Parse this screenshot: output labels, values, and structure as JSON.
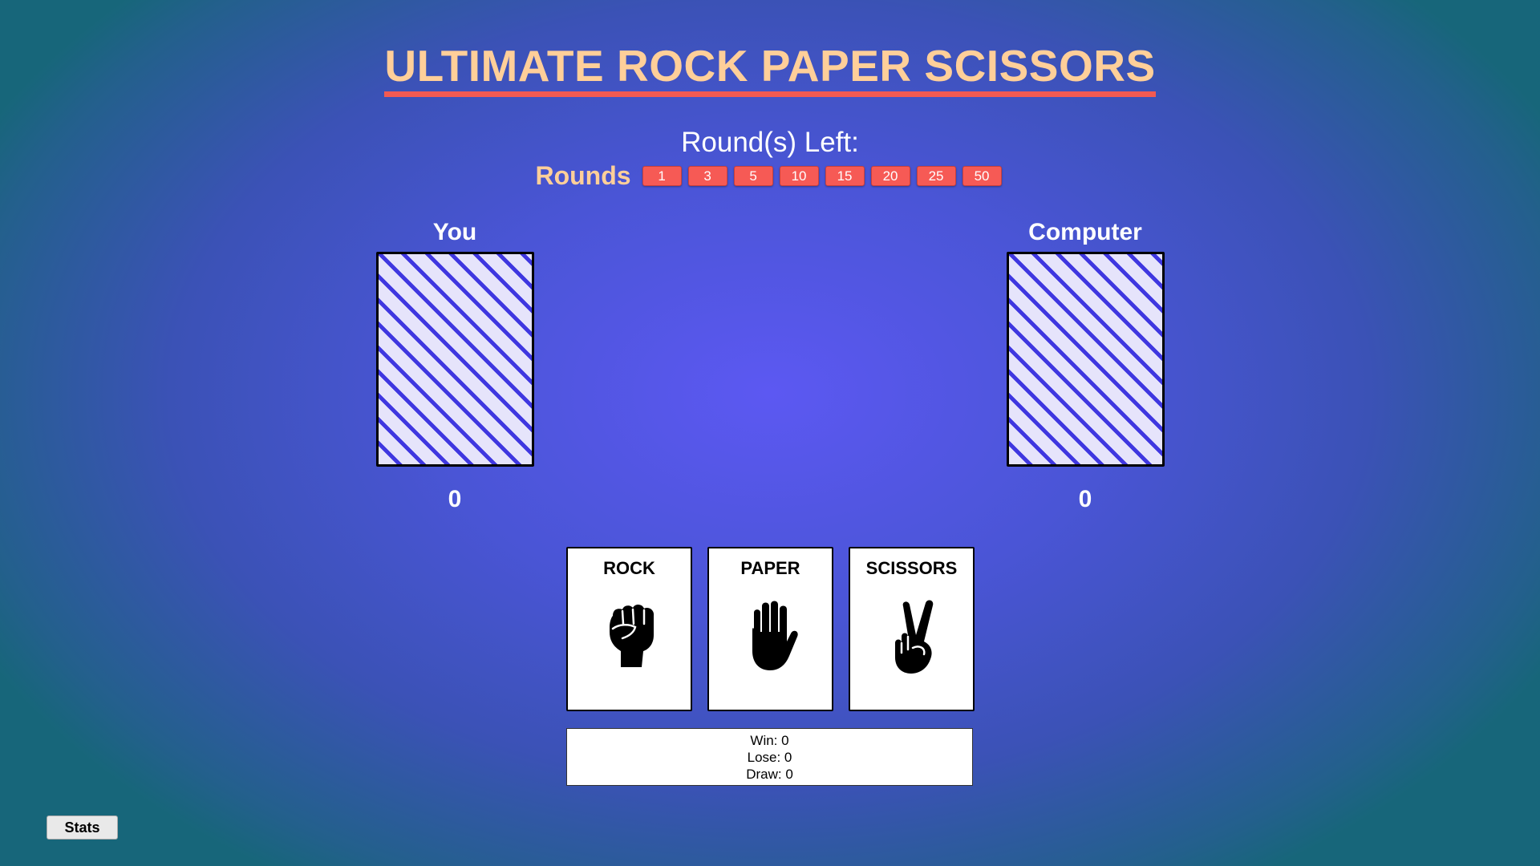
{
  "title": "ULTIMATE ROCK PAPER SCISSORS",
  "rounds_left_label": "Round(s) Left:",
  "rounds": {
    "label": "Rounds",
    "options": [
      "1",
      "3",
      "5",
      "10",
      "15",
      "20",
      "25",
      "50"
    ]
  },
  "players": {
    "you": {
      "name": "You",
      "score": "0"
    },
    "computer": {
      "name": "Computer",
      "score": "0"
    }
  },
  "choices": [
    {
      "label": "ROCK",
      "icon": "fist-icon"
    },
    {
      "label": "PAPER",
      "icon": "open-hand-icon"
    },
    {
      "label": "SCISSORS",
      "icon": "peace-hand-icon"
    }
  ],
  "stats": {
    "win": "Win: 0",
    "lose": "Lose: 0",
    "draw": "Draw: 0"
  },
  "stats_button": "Stats",
  "colors": {
    "title": "#ffcf99",
    "title_underline": "#f25a52",
    "round_button": "#f65a55",
    "card_stripe": "#3f37e0"
  }
}
